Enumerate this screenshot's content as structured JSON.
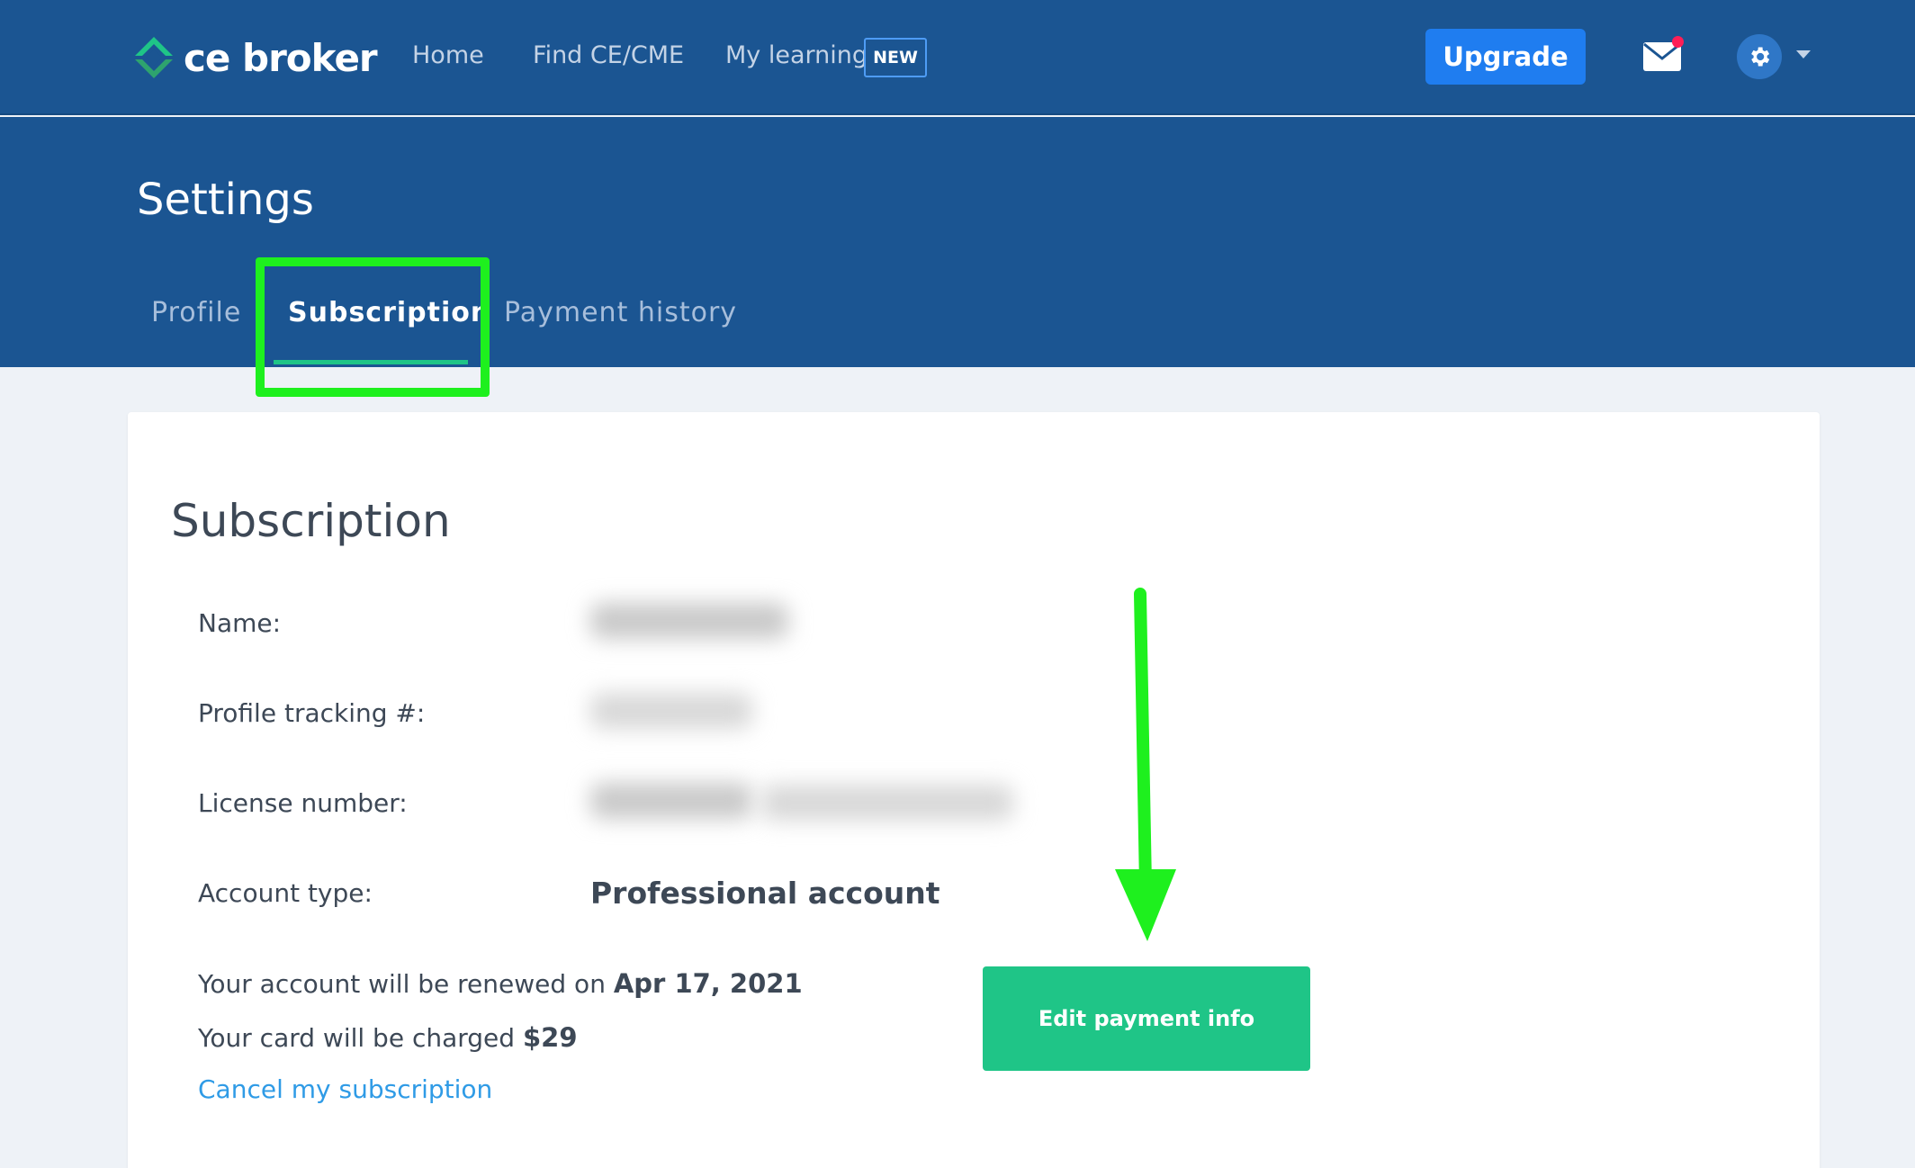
{
  "brand": {
    "logo_text": "ce broker",
    "accent_green": "#1fc587",
    "nav_blue": "#1b5592"
  },
  "nav": {
    "home": "Home",
    "find": "Find CE/CME",
    "learning": "My learning",
    "learning_badge": "NEW",
    "upgrade": "Upgrade"
  },
  "header": {
    "title": "Settings",
    "tabs": [
      {
        "label": "Profile",
        "active": false
      },
      {
        "label": "Subscription",
        "active": true
      },
      {
        "label": "Payment history",
        "active": false
      }
    ]
  },
  "subscription": {
    "title": "Subscription",
    "name_label": "Name:",
    "tracking_label": "Profile tracking #:",
    "license_label": "License number:",
    "account_type_label": "Account type:",
    "account_type_value": "Professional account",
    "renew_text": "Your account will be renewed on",
    "renew_date": "Apr 17, 2021",
    "charge_text": "Your card will be charged",
    "charge_amount": "$29",
    "cancel_link": "Cancel my subscription",
    "edit_button": "Edit payment info"
  },
  "annotation": {
    "highlight_color": "#1ef01e"
  }
}
